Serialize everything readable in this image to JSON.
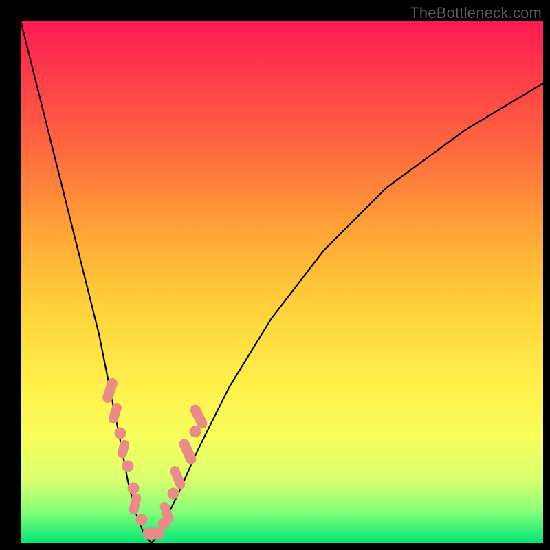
{
  "watermark": "TheBottleneck.com",
  "chart_data": {
    "type": "line",
    "title": "",
    "xlabel": "",
    "ylabel": "",
    "xlim": [
      0,
      100
    ],
    "ylim": [
      0,
      100
    ],
    "x": [
      0,
      3,
      6,
      9,
      12,
      15,
      17,
      19,
      20.5,
      22,
      23.5,
      25,
      26,
      27,
      30,
      34,
      40,
      48,
      58,
      70,
      85,
      100
    ],
    "values": [
      100,
      88,
      76,
      64,
      52,
      40,
      30,
      20,
      12,
      6,
      2,
      0,
      1,
      3,
      9,
      18,
      30,
      43,
      56,
      68,
      79,
      88
    ],
    "overlay_points": {
      "comment": "salmon capsule markers along the curve near the trough",
      "x": [
        17,
        18,
        19,
        20,
        21,
        22,
        23,
        24,
        25,
        26,
        27,
        28,
        29,
        30,
        31,
        32
      ],
      "y": [
        30,
        25,
        20,
        15,
        10,
        6,
        3,
        1,
        0,
        1,
        3,
        6,
        9,
        12,
        15,
        18
      ]
    },
    "background_gradient": {
      "stops": [
        {
          "pos": 0.0,
          "color": "#ff1a55"
        },
        {
          "pos": 0.25,
          "color": "#ff6a3e"
        },
        {
          "pos": 0.55,
          "color": "#ffd23a"
        },
        {
          "pos": 0.8,
          "color": "#f8ff5c"
        },
        {
          "pos": 1.0,
          "color": "#00e676"
        }
      ]
    }
  }
}
